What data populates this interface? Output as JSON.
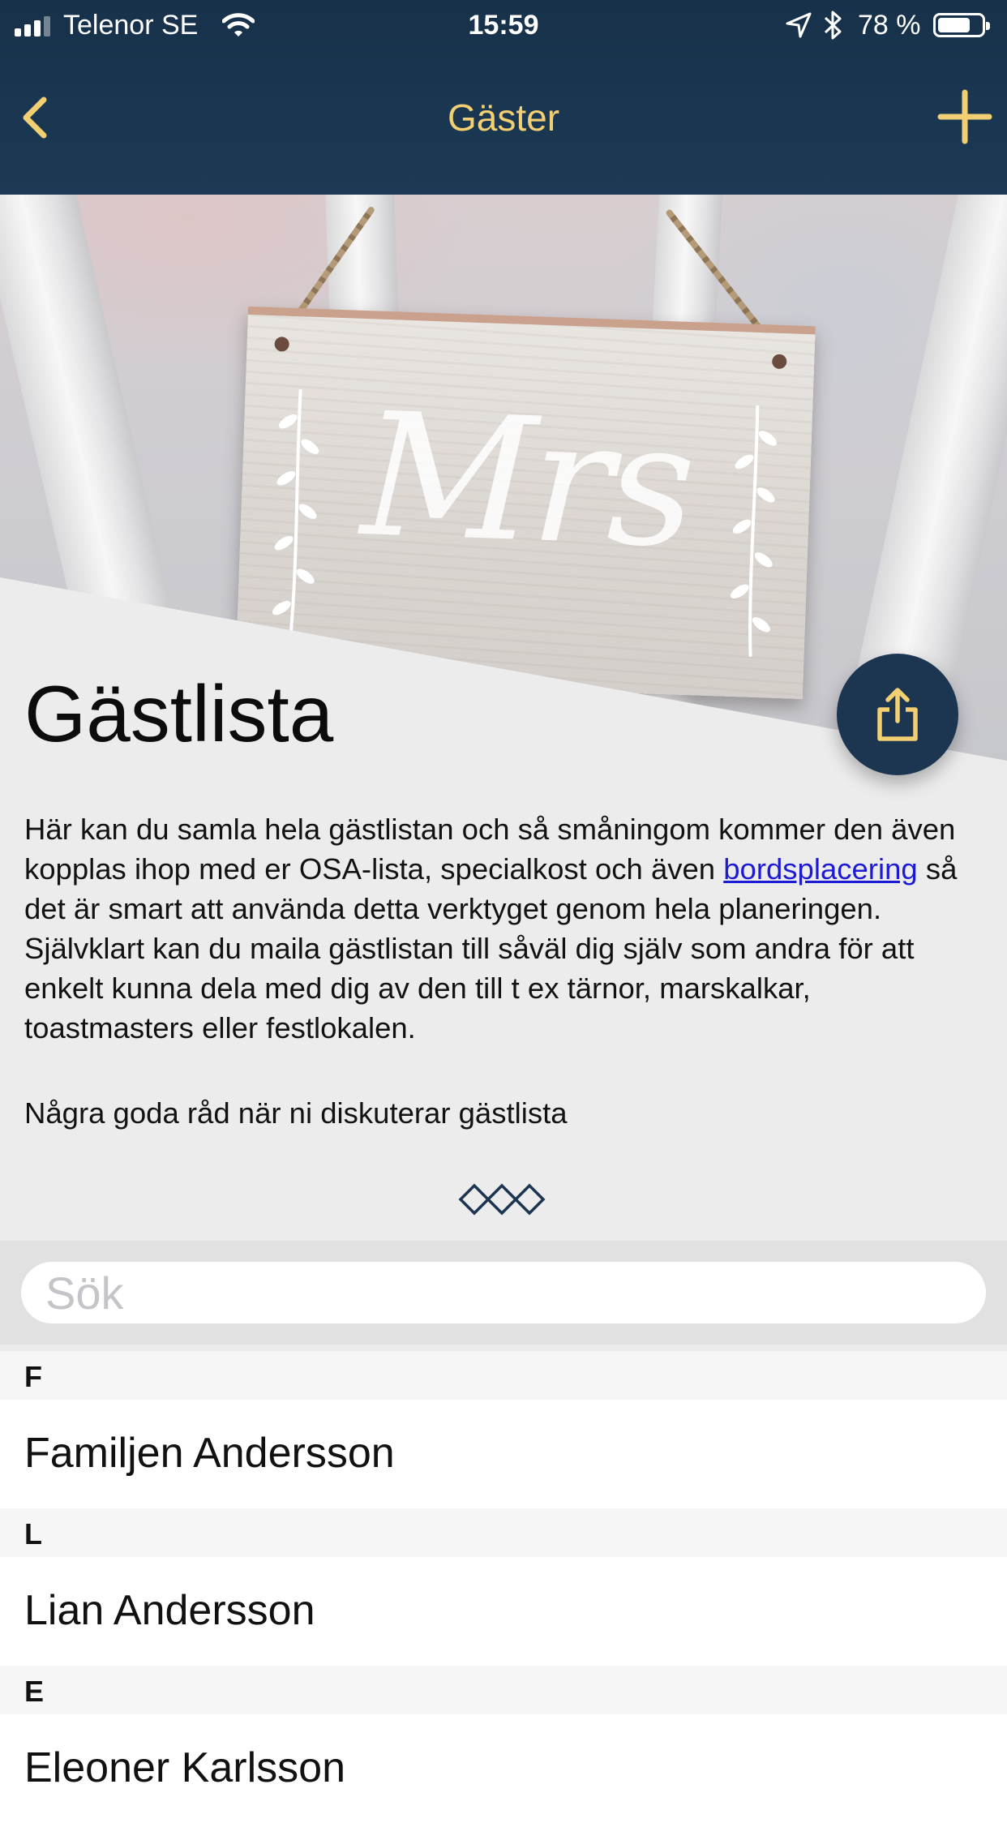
{
  "status_bar": {
    "carrier": "Telenor SE",
    "time": "15:59",
    "battery_percent": "78 %",
    "battery_level": 0.78
  },
  "nav": {
    "title": "Gäster",
    "back_icon": "chevron-left-icon",
    "add_icon": "plus-icon"
  },
  "colors": {
    "nav_background": "#1c3a55",
    "accent_gold": "#f2cf72",
    "share_button": "#1c3550",
    "link": "#1d1ad6"
  },
  "hero": {
    "sign_text": "Mrs"
  },
  "page": {
    "title": "Gästlista",
    "intro_before_link": "Här kan du samla hela gästlistan och så småningom kommer den även kopplas ihop med er OSA-lista, specialkost och även ",
    "intro_link": "bordsplacering",
    "intro_after_link": " så det är smart att använda detta verktyget genom hela planeringen. Självklart kan du maila gästlistan till såväl dig själv som andra för att enkelt kunna dela med dig av den till t ex tärnor, marskalkar, toastmasters eller festlokalen.",
    "tips_link": "Några goda råd när ni diskuterar gästlista"
  },
  "search": {
    "placeholder": "Sök",
    "value": ""
  },
  "guests": [
    {
      "section": "F",
      "name": "Familjen Andersson"
    },
    {
      "section": "L",
      "name": "Lian Andersson"
    },
    {
      "section": "E",
      "name": "Eleoner Karlsson"
    }
  ]
}
